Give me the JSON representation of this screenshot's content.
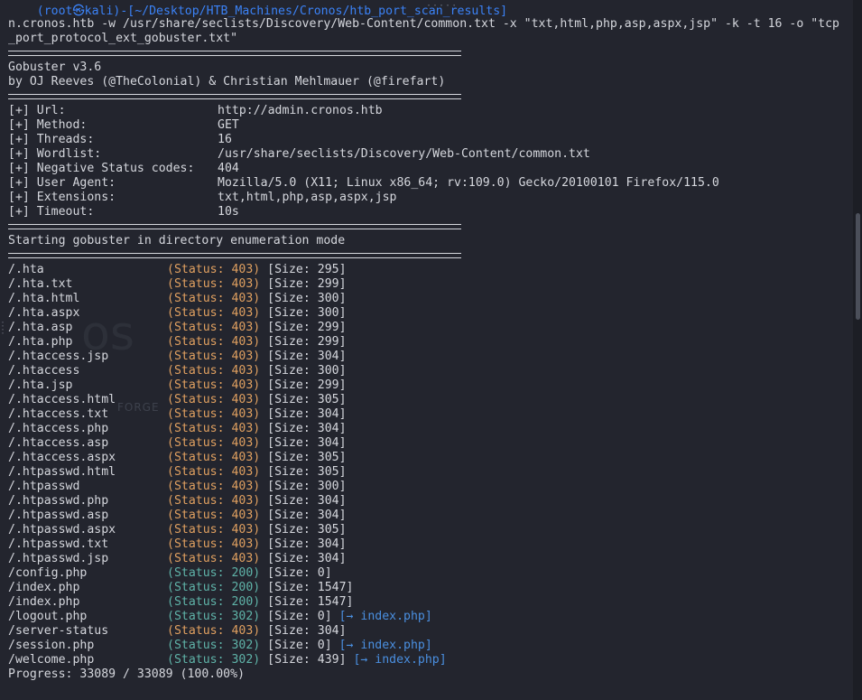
{
  "prompt_fragment": "(root㉿kali)-[~/Desktop/HTB_Machines/Cronos/htb_port_scan_results]",
  "command": {
    "line1": "n.cronos.htb -w /usr/share/seclists/Discovery/Web-Content/common.txt -x \"txt,html,php,asp,aspx,jsp\" -k -t 16 -o \"tcp",
    "line2": "_port_protocol_ext_gobuster.txt\""
  },
  "banner": {
    "version": "Gobuster v3.6",
    "authors": "by OJ Reeves (@TheColonial) & Christian Mehlmauer (@firefart)"
  },
  "config": [
    {
      "label": "[+] Url:",
      "value": "http://admin.cronos.htb"
    },
    {
      "label": "[+] Method:",
      "value": "GET"
    },
    {
      "label": "[+] Threads:",
      "value": "16"
    },
    {
      "label": "[+] Wordlist:",
      "value": "/usr/share/seclists/Discovery/Web-Content/common.txt"
    },
    {
      "label": "[+] Negative Status codes:",
      "value": "404"
    },
    {
      "label": "[+] User Agent:",
      "value": "Mozilla/5.0 (X11; Linux x86_64; rv:109.0) Gecko/20100101 Firefox/115.0"
    },
    {
      "label": "[+] Extensions:",
      "value": "txt,html,php,asp,aspx,jsp"
    },
    {
      "label": "[+] Timeout:",
      "value": "10s"
    }
  ],
  "mode_message": "Starting gobuster in directory enumeration mode",
  "results": [
    {
      "path": "/.hta",
      "status": "(Status: 403)",
      "code": "403",
      "size": "[Size: 295]",
      "redirect": ""
    },
    {
      "path": "/.hta.txt",
      "status": "(Status: 403)",
      "code": "403",
      "size": "[Size: 299]",
      "redirect": ""
    },
    {
      "path": "/.hta.html",
      "status": "(Status: 403)",
      "code": "403",
      "size": "[Size: 300]",
      "redirect": ""
    },
    {
      "path": "/.hta.aspx",
      "status": "(Status: 403)",
      "code": "403",
      "size": "[Size: 300]",
      "redirect": ""
    },
    {
      "path": "/.hta.asp",
      "status": "(Status: 403)",
      "code": "403",
      "size": "[Size: 299]",
      "redirect": ""
    },
    {
      "path": "/.hta.php",
      "status": "(Status: 403)",
      "code": "403",
      "size": "[Size: 299]",
      "redirect": ""
    },
    {
      "path": "/.htaccess.jsp",
      "status": "(Status: 403)",
      "code": "403",
      "size": "[Size: 304]",
      "redirect": ""
    },
    {
      "path": "/.htaccess",
      "status": "(Status: 403)",
      "code": "403",
      "size": "[Size: 300]",
      "redirect": ""
    },
    {
      "path": "/.hta.jsp",
      "status": "(Status: 403)",
      "code": "403",
      "size": "[Size: 299]",
      "redirect": ""
    },
    {
      "path": "/.htaccess.html",
      "status": "(Status: 403)",
      "code": "403",
      "size": "[Size: 305]",
      "redirect": ""
    },
    {
      "path": "/.htaccess.txt",
      "status": "(Status: 403)",
      "code": "403",
      "size": "[Size: 304]",
      "redirect": ""
    },
    {
      "path": "/.htaccess.php",
      "status": "(Status: 403)",
      "code": "403",
      "size": "[Size: 304]",
      "redirect": ""
    },
    {
      "path": "/.htaccess.asp",
      "status": "(Status: 403)",
      "code": "403",
      "size": "[Size: 304]",
      "redirect": ""
    },
    {
      "path": "/.htaccess.aspx",
      "status": "(Status: 403)",
      "code": "403",
      "size": "[Size: 305]",
      "redirect": ""
    },
    {
      "path": "/.htpasswd.html",
      "status": "(Status: 403)",
      "code": "403",
      "size": "[Size: 305]",
      "redirect": ""
    },
    {
      "path": "/.htpasswd",
      "status": "(Status: 403)",
      "code": "403",
      "size": "[Size: 300]",
      "redirect": ""
    },
    {
      "path": "/.htpasswd.php",
      "status": "(Status: 403)",
      "code": "403",
      "size": "[Size: 304]",
      "redirect": ""
    },
    {
      "path": "/.htpasswd.asp",
      "status": "(Status: 403)",
      "code": "403",
      "size": "[Size: 304]",
      "redirect": ""
    },
    {
      "path": "/.htpasswd.aspx",
      "status": "(Status: 403)",
      "code": "403",
      "size": "[Size: 305]",
      "redirect": ""
    },
    {
      "path": "/.htpasswd.txt",
      "status": "(Status: 403)",
      "code": "403",
      "size": "[Size: 304]",
      "redirect": ""
    },
    {
      "path": "/.htpasswd.jsp",
      "status": "(Status: 403)",
      "code": "403",
      "size": "[Size: 304]",
      "redirect": ""
    },
    {
      "path": "/config.php",
      "status": "(Status: 200)",
      "code": "200",
      "size": "[Size: 0]",
      "redirect": ""
    },
    {
      "path": "/index.php",
      "status": "(Status: 200)",
      "code": "200",
      "size": "[Size: 1547]",
      "redirect": ""
    },
    {
      "path": "/index.php",
      "status": "(Status: 200)",
      "code": "200",
      "size": "[Size: 1547]",
      "redirect": ""
    },
    {
      "path": "/logout.php",
      "status": "(Status: 302)",
      "code": "302",
      "size": "[Size: 0]",
      "redirect": "[→ index.php]"
    },
    {
      "path": "/server-status",
      "status": "(Status: 403)",
      "code": "403",
      "size": "[Size: 304]",
      "redirect": ""
    },
    {
      "path": "/session.php",
      "status": "(Status: 302)",
      "code": "302",
      "size": "[Size: 0]",
      "redirect": "[→ index.php]"
    },
    {
      "path": "/welcome.php",
      "status": "(Status: 302)",
      "code": "302",
      "size": "[Size: 439]",
      "redirect": "[→ index.php]"
    }
  ],
  "progress": "Progress: 33089 / 33089 (100.00%)",
  "colors": {
    "background": "#23252e",
    "text": "#d5d7dd",
    "status_403": "#e0a060",
    "status_200": "#5fb3a8",
    "redirect": "#4a8fe0"
  }
}
